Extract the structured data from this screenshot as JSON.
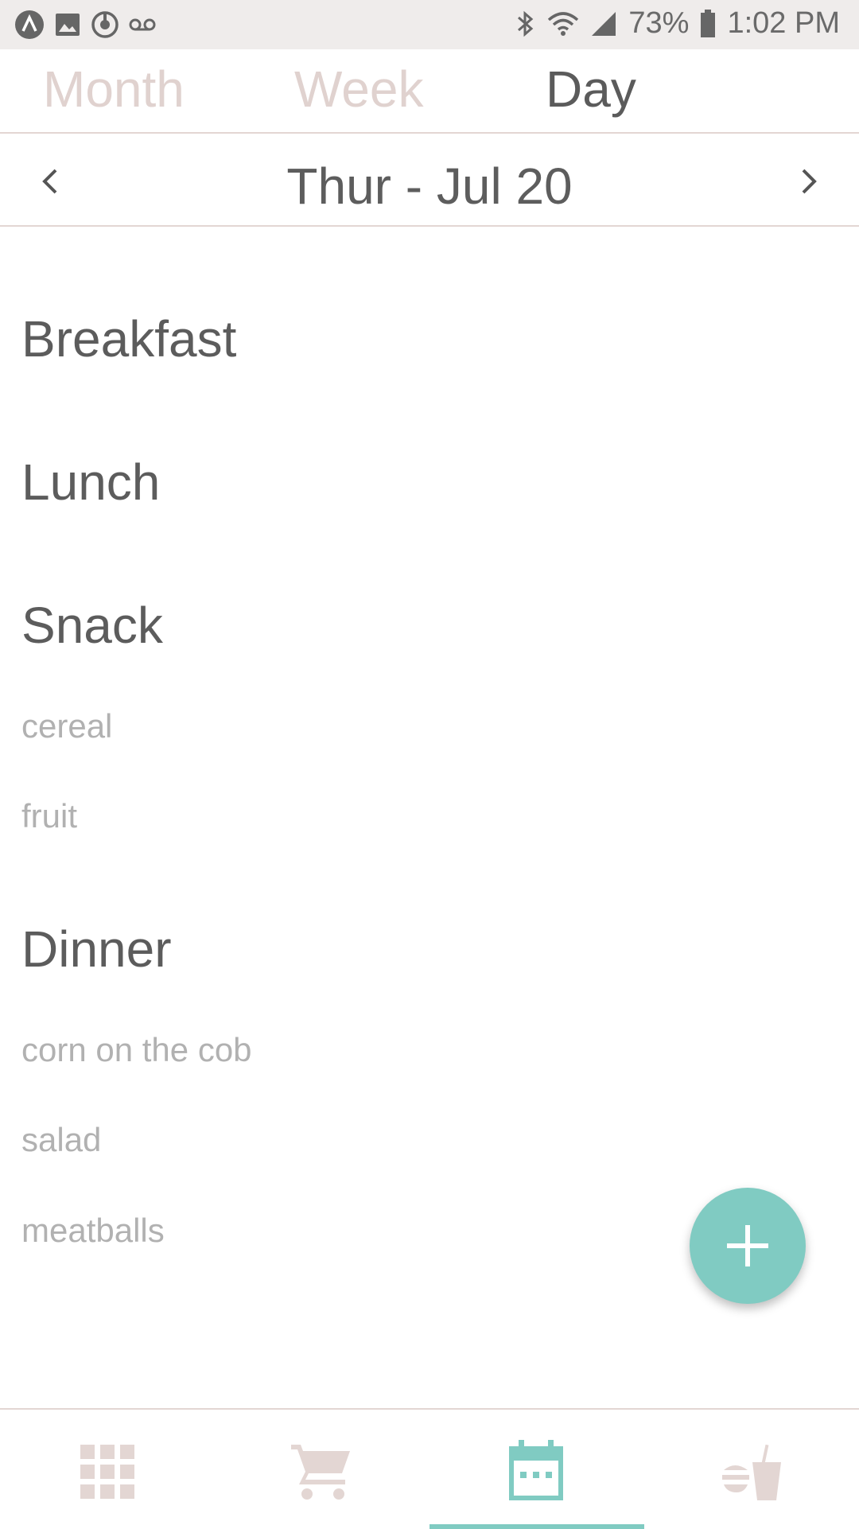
{
  "status_bar": {
    "icons_left": [
      "app-logo-icon",
      "image-icon",
      "sync-icon",
      "voicemail-icon"
    ],
    "icons_right": [
      "bluetooth-icon",
      "wifi-icon",
      "signal-icon",
      "battery-icon"
    ],
    "battery": "73%",
    "time": "1:02 PM"
  },
  "tabs": [
    {
      "label": "Month",
      "active": false
    },
    {
      "label": "Week",
      "active": false
    },
    {
      "label": "Day",
      "active": true
    }
  ],
  "date_nav": {
    "prev_icon": "chevron-left-icon",
    "next_icon": "chevron-right-icon",
    "date": "Thur - Jul 20"
  },
  "meals": {
    "breakfast": {
      "title": "Breakfast",
      "items": []
    },
    "lunch": {
      "title": "Lunch",
      "items": []
    },
    "snack": {
      "title": "Snack",
      "items": [
        "cereal",
        "fruit"
      ]
    },
    "dinner": {
      "title": "Dinner",
      "items": [
        "corn on the cob",
        "salad",
        "meatballs"
      ]
    }
  },
  "fab": {
    "icon": "plus-icon"
  },
  "bottom_nav": [
    {
      "icon": "grid-icon",
      "active": false
    },
    {
      "icon": "cart-icon",
      "active": false
    },
    {
      "icon": "calendar-icon",
      "active": true
    },
    {
      "icon": "food-drink-icon",
      "active": false
    }
  ],
  "colors": {
    "accent": "#80cbc2",
    "inactive_tab": "#e0d2cf",
    "divider": "#e3d6d3",
    "status_bar_bg": "#efeceb"
  }
}
